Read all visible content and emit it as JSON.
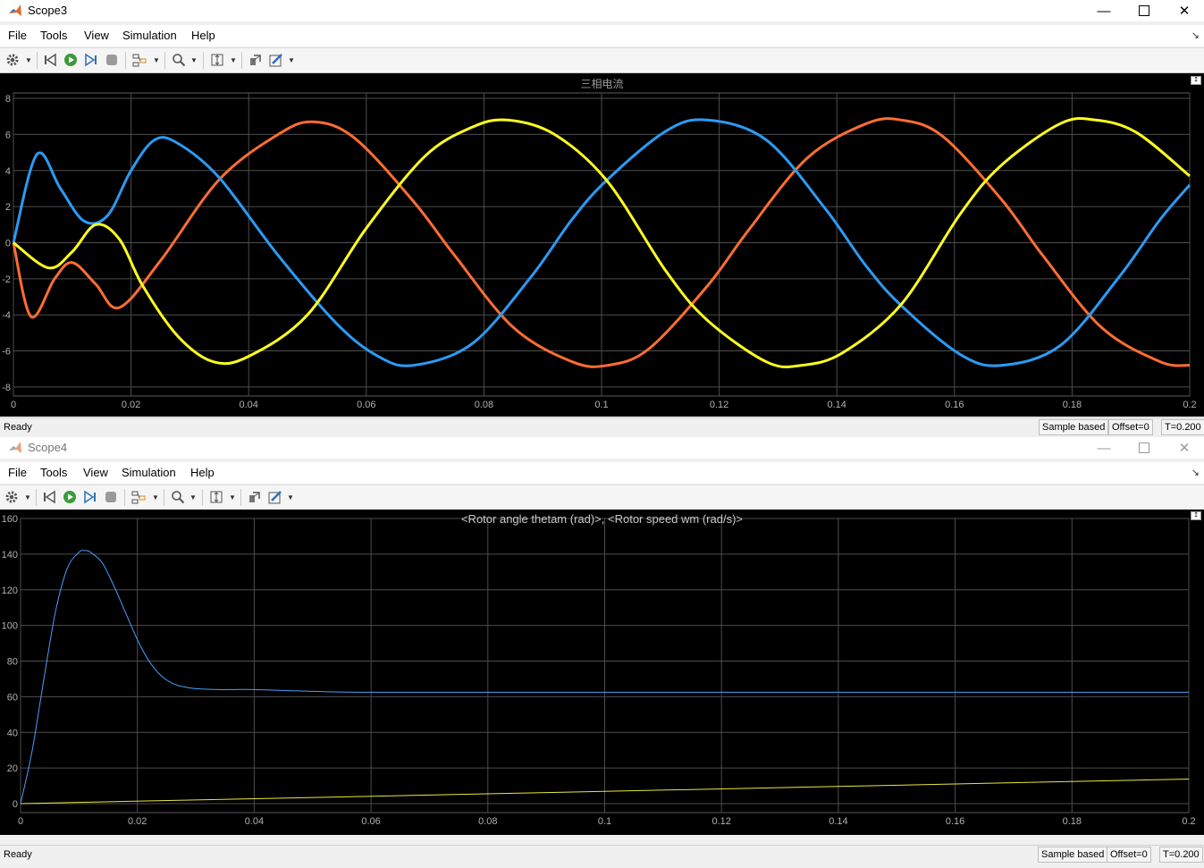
{
  "scope3": {
    "window_title": "Scope3",
    "menu": [
      "File",
      "Tools",
      "View",
      "Simulation",
      "Help"
    ],
    "status": {
      "ready": "Ready",
      "sample_mode": "Sample based",
      "offset": "Offset=0",
      "time": "T=0.200"
    }
  },
  "scope4": {
    "window_title": "Scope4",
    "menu": [
      "File",
      "Tools",
      "View",
      "Simulation",
      "Help"
    ],
    "status": {
      "ready": "Ready",
      "sample_mode": "Sample based",
      "offset": "Offset=0",
      "time": "T=0.200"
    }
  },
  "icons": [
    "settings-gear-icon",
    "rewind-icon",
    "run-icon",
    "step-forward-icon",
    "stop-icon",
    "highlight-block-icon",
    "zoom-icon",
    "autoscale-icon",
    "restore-layout-icon",
    "style-icon"
  ],
  "colors": {
    "phase_a": "#ff6d32",
    "phase_b": "#2b9bf4",
    "phase_c": "#ffff20",
    "grid": "#4d4d4d",
    "tick_label": "#b0b0b0",
    "trace_theta": "#e8e840",
    "trace_wm": "#4d9eff"
  },
  "chart_data": [
    {
      "type": "line",
      "title": "三相电流",
      "xlabel": "",
      "ylabel": "",
      "xlim": [
        0,
        0.2
      ],
      "ylim": [
        -8.5,
        8.3
      ],
      "xticks": [
        "0",
        "0.02",
        "0.04",
        "0.06",
        "0.08",
        "0.1",
        "0.12",
        "0.14",
        "0.16",
        "0.18",
        "0.2"
      ],
      "yticks": [
        "-8",
        "-6",
        "-4",
        "-2",
        "0",
        "2",
        "4",
        "6",
        "8"
      ],
      "grid": true,
      "series": [
        {
          "x": [
            0,
            0.003,
            0.007,
            0.01,
            0.014,
            0.018,
            0.025,
            0.035,
            0.045,
            0.051,
            0.058,
            0.068,
            0.075,
            0.085,
            0.095,
            0.101,
            0.108,
            0.118,
            0.125,
            0.135,
            0.145,
            0.151,
            0.158,
            0.168,
            0.175,
            0.185,
            0.195,
            0.2
          ],
          "y": [
            0,
            -4.1,
            -2.0,
            -1.1,
            -2.3,
            -3.6,
            -1.0,
            3.5,
            6.0,
            6.7,
            5.8,
            2.3,
            -0.7,
            -4.7,
            -6.6,
            -6.8,
            -5.9,
            -2.4,
            0.7,
            4.7,
            6.6,
            6.8,
            5.9,
            2.4,
            -0.7,
            -4.7,
            -6.6,
            -6.8
          ]
        },
        {
          "x": [
            0,
            0.004,
            0.008,
            0.012,
            0.016,
            0.02,
            0.024,
            0.028,
            0.035,
            0.045,
            0.055,
            0.062,
            0.068,
            0.078,
            0.088,
            0.095,
            0.101,
            0.111,
            0.118,
            0.128,
            0.138,
            0.145,
            0.151,
            0.161,
            0.168,
            0.178,
            0.188,
            0.195,
            0.2
          ],
          "y": [
            0,
            4.9,
            3.0,
            1.2,
            1.5,
            4.0,
            5.7,
            5.5,
            3.6,
            -0.7,
            -4.5,
            -6.3,
            -6.8,
            -5.6,
            -1.9,
            1.3,
            3.5,
            6.2,
            6.8,
            5.7,
            1.9,
            -1.3,
            -3.5,
            -6.2,
            -6.8,
            -5.7,
            -1.9,
            1.3,
            3.2
          ]
        },
        {
          "x": [
            0,
            0.006,
            0.01,
            0.014,
            0.018,
            0.022,
            0.028,
            0.034,
            0.04,
            0.05,
            0.06,
            0.07,
            0.078,
            0.084,
            0.092,
            0.101,
            0.111,
            0.118,
            0.128,
            0.134,
            0.141,
            0.151,
            0.161,
            0.168,
            0.178,
            0.184,
            0.191,
            0.2
          ],
          "y": [
            0,
            -1.4,
            -0.5,
            1.0,
            0.2,
            -2.4,
            -5.2,
            -6.6,
            -6.3,
            -4.0,
            0.8,
            4.8,
            6.4,
            6.8,
            6.0,
            3.4,
            -1.6,
            -4.3,
            -6.6,
            -6.8,
            -6.1,
            -3.4,
            1.6,
            4.3,
            6.6,
            6.8,
            6.1,
            3.7
          ]
        }
      ]
    },
    {
      "type": "line",
      "title": "<Rotor angle thetam (rad)>, <Rotor speed wm (rad/s)>",
      "xlabel": "",
      "ylabel": "",
      "xlim": [
        0,
        0.2
      ],
      "ylim": [
        -5,
        160
      ],
      "xticks": [
        "0",
        "0.02",
        "0.04",
        "0.06",
        "0.08",
        "0.1",
        "0.12",
        "0.14",
        "0.16",
        "0.18",
        "0.2"
      ],
      "yticks": [
        "0",
        "20",
        "40",
        "60",
        "80",
        "100",
        "120",
        "140",
        "160"
      ],
      "grid": true,
      "series": [
        {
          "x": [
            0,
            0.2
          ],
          "y": [
            0,
            13.8
          ]
        },
        {
          "x": [
            0,
            0.002,
            0.004,
            0.006,
            0.008,
            0.01,
            0.011,
            0.012,
            0.014,
            0.016,
            0.018,
            0.02,
            0.022,
            0.024,
            0.026,
            0.028,
            0.03,
            0.034,
            0.04,
            0.05,
            0.06,
            0.1,
            0.2
          ],
          "y": [
            0,
            30,
            70,
            108,
            132,
            141,
            142,
            141,
            135,
            122,
            107,
            92,
            80,
            72,
            67.5,
            65.5,
            64.5,
            64,
            64,
            63,
            62.5,
            62.5,
            62.5
          ]
        }
      ]
    }
  ]
}
